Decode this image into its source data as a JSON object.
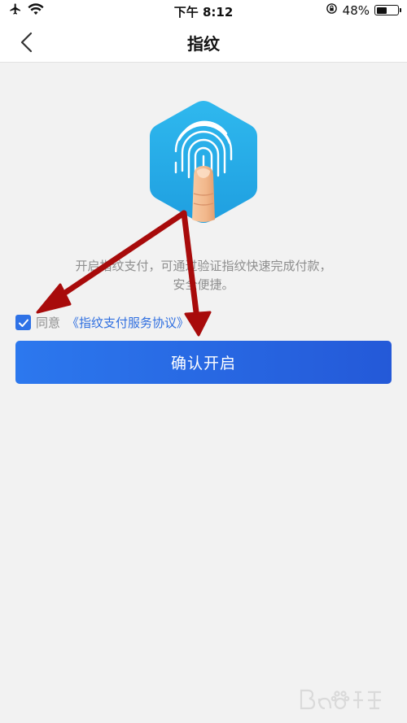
{
  "status_bar": {
    "time": "下午 8:12",
    "battery_percent": "48%",
    "battery_level": 0.48
  },
  "nav": {
    "title": "指纹"
  },
  "content": {
    "description_line1": "开启指纹支付，可通过验证指纹快速完成付款，",
    "description_line2": "安全便捷。",
    "agree_label": "同意",
    "agreement_link": "《指纹支付服务协议》",
    "agree_checked": true,
    "confirm_button": "确认开启"
  },
  "colors": {
    "primary": "#2f72e6",
    "hero_hexagon": "#29aee8",
    "annotation_arrow": "#b00000",
    "background": "#f2f2f2"
  },
  "icons": {
    "back": "chevron-left-icon",
    "airplane": "airplane-icon",
    "wifi": "wifi-icon",
    "rotation_lock": "rotation-lock-icon",
    "battery": "battery-icon",
    "check": "check-icon",
    "fingerprint": "fingerprint-icon"
  }
}
